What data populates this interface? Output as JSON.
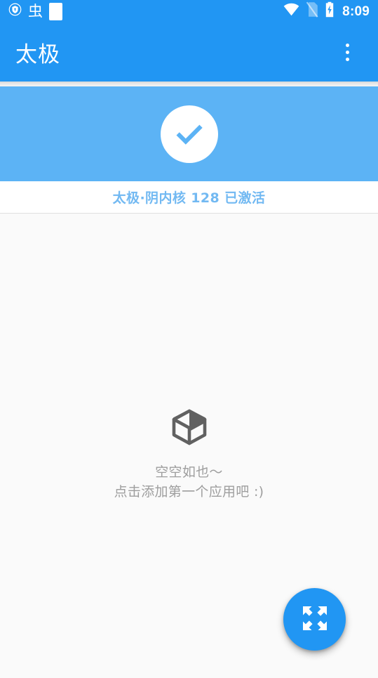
{
  "status_bar": {
    "left_icons": [
      {
        "name": "vpn-shield-icon",
        "label": "VPN active"
      },
      {
        "name": "debug-bug-icon",
        "label": "虫"
      },
      {
        "name": "blank-notification-icon",
        "label": ""
      }
    ],
    "right_icons": [
      {
        "name": "wifi-icon",
        "label": "Wi-Fi"
      },
      {
        "name": "no-sim-icon",
        "label": "No SIM"
      },
      {
        "name": "battery-charging-icon",
        "label": "Charging"
      }
    ],
    "clock": "8:09"
  },
  "app_bar": {
    "title": "太极",
    "overflow_label": "More options"
  },
  "banner": {
    "icon": "check-circle-icon",
    "status_text": "太极·阴内核 128 已激活"
  },
  "empty_state": {
    "icon": "open-box-icon",
    "line1": "空空如也～",
    "line2": "点击添加第一个应用吧 :)"
  },
  "fab": {
    "icon": "expand-arrows-icon",
    "label": "Add application"
  },
  "colors": {
    "primary": "#2196F3",
    "banner": "#5CB3F5",
    "status_text": "#72B9F2",
    "background": "#FAFAFA",
    "empty_text": "#9E9E9E",
    "empty_icon": "#616161"
  }
}
